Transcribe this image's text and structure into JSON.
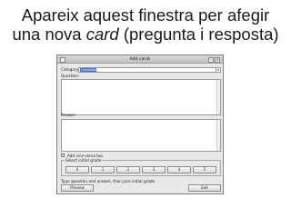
{
  "slide": {
    "title_line1": "Apareix aquest finestra per afegir",
    "title_line2_before": "una nova ",
    "title_line2_italic": "card",
    "title_line2_after": " (pregunta i resposta)"
  },
  "dialog": {
    "title": "Add cards",
    "close_glyph": "×",
    "minimize_glyph": "–",
    "category_label": "Category:",
    "category_value": "Unsorted",
    "dropdown_glyph": "▾",
    "question_label": "Question:",
    "question_value": "",
    "answer_label": "Answer:",
    "answer_value": "",
    "checkbox_label": "Add vice-versa too",
    "checkbox_checked": false,
    "grade_group_label": "Select initial grade",
    "grades": [
      "0",
      "1",
      "2",
      "3",
      "4",
      "5"
    ],
    "hint": "Type question and answer, then pick initial grade.",
    "preview_label": "Preview",
    "exit_label": "Exit"
  }
}
